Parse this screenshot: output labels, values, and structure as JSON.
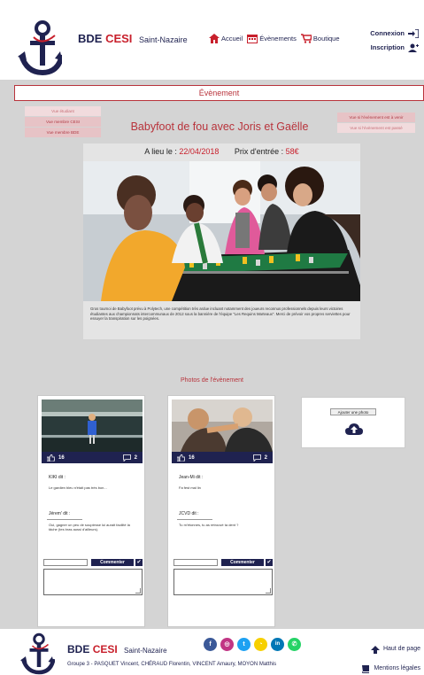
{
  "header": {
    "brand_prefix": "BDE",
    "brand_name": "CESI",
    "brand_city": "Saint-Nazaire",
    "nav": [
      {
        "label": "Accueil",
        "icon": "home-icon"
      },
      {
        "label": "Évènements",
        "icon": "calendar-icon"
      },
      {
        "label": "Boutique",
        "icon": "cart-icon"
      }
    ],
    "login": "Connexion",
    "signup": "Inscription"
  },
  "section_title": "Évènement",
  "filters_left": [
    "Vue étudiant",
    "Vue membre CESI",
    "Vue membre BDE"
  ],
  "filters_right": [
    "Vue si l'évènement est à venir",
    "Vue si l'évènement est passé"
  ],
  "event": {
    "title": "Babyfoot de fou avec Joris et Gaëlle",
    "date_label": "A lieu le :",
    "date": "22/04/2018",
    "price_label": "Prix d'entrée :",
    "price": "58€",
    "description": "Gros tournoi de Babyfoot prévu à Polytech, une compétition très ardue incluant notamment des joueurs reconnus professionnels depuis leurs victoires étudiantes aux championnats intercommunaux de 2012 sous la bannière de l'équipe \"Les Requins Marteaux\". Merci de prévoir vos propres serviettes pour essuyer la transpiration sur les poignées."
  },
  "photos_title": "Photos de l'évènement",
  "photos": [
    {
      "likes": "16",
      "comments_count": "2",
      "comments": [
        {
          "author": "KIKI dit :",
          "text": "Le gardien bleu n'était pas très bon..."
        },
        {
          "author": "Jérem' dit :",
          "text": "Oui, gagner un peu de souplesse lui aurait facilité la tâche (tes bras aussi d'ailleurs)."
        }
      ],
      "button": "Commenter"
    },
    {
      "likes": "16",
      "comments_count": "2",
      "comments": [
        {
          "author": "Jean-Mi dit :",
          "text": "Fa fest mal lin"
        },
        {
          "author": "JCVD dit :",
          "text": "Tu m'étonnes, tu as retrouvé ta dent ?"
        }
      ],
      "button": "Commenter"
    }
  ],
  "add_photo": "Ajouter une photo",
  "footer": {
    "brand_prefix": "BDE",
    "brand_name": "CESI",
    "brand_city": "Saint-Nazaire",
    "group": "Groupe 3 - PASQUET Vincent, CHÉRAUD Florentin, VINCENT Amaury, MOYON Matthis",
    "top_link": "Haut de page",
    "legal_link": "Mentions légales",
    "socials": [
      {
        "name": "facebook-icon",
        "letter": "f",
        "color": "#3b5998"
      },
      {
        "name": "instagram-icon",
        "letter": "◎",
        "color": "#c13584"
      },
      {
        "name": "twitter-icon",
        "letter": "t",
        "color": "#1da1f2"
      },
      {
        "name": "snapchat-icon",
        "letter": "◔",
        "color": "#f7d000"
      },
      {
        "name": "linkedin-icon",
        "letter": "in",
        "color": "#0077b5"
      },
      {
        "name": "whatsapp-icon",
        "letter": "✆",
        "color": "#25d366"
      }
    ]
  }
}
